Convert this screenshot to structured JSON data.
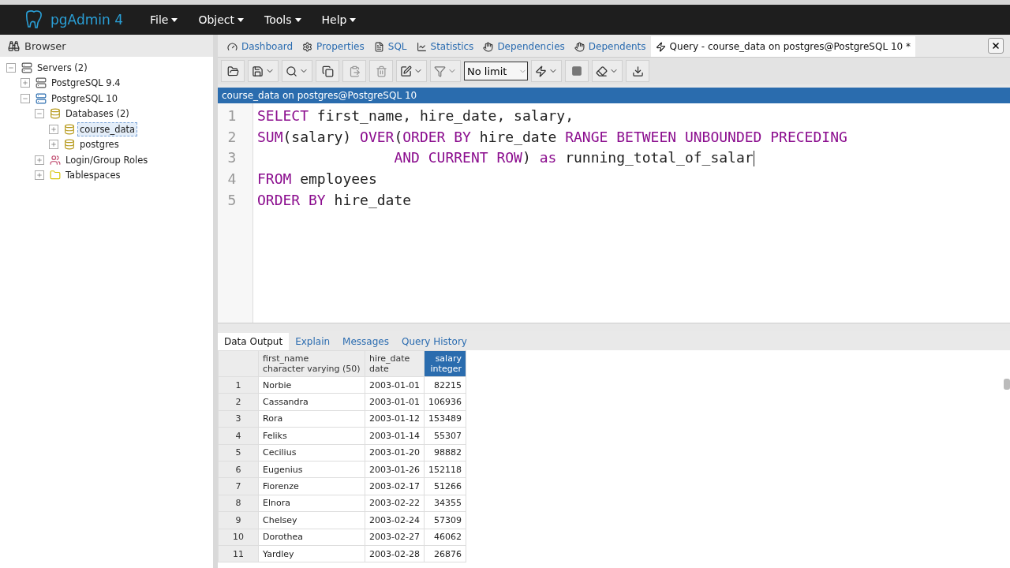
{
  "navbar": {
    "brand": "pgAdmin 4",
    "menus": [
      {
        "label": "File"
      },
      {
        "label": "Object"
      },
      {
        "label": "Tools"
      },
      {
        "label": "Help"
      }
    ]
  },
  "browser": {
    "title": "Browser",
    "tree": [
      {
        "label": "Servers (2)",
        "kind": "servers",
        "expanded": true,
        "selected": false,
        "children": [
          {
            "label": "PostgreSQL 9.4",
            "kind": "server-off",
            "expanded": false,
            "selected": false
          },
          {
            "label": "PostgreSQL 10",
            "kind": "server",
            "expanded": true,
            "selected": false,
            "children": [
              {
                "label": "Databases (2)",
                "kind": "database",
                "expanded": true,
                "selected": false,
                "children": [
                  {
                    "label": "course_data",
                    "kind": "database",
                    "expanded": false,
                    "selected": true
                  },
                  {
                    "label": "postgres",
                    "kind": "database",
                    "expanded": false,
                    "selected": false
                  }
                ]
              },
              {
                "label": "Login/Group Roles",
                "kind": "roles",
                "expanded": false,
                "selected": false
              },
              {
                "label": "Tablespaces",
                "kind": "folder",
                "expanded": false,
                "selected": false
              }
            ]
          }
        ]
      }
    ]
  },
  "tabs": [
    {
      "label": "Dashboard",
      "kind": "dashboard",
      "selected": false
    },
    {
      "label": "Properties",
      "kind": "properties",
      "selected": false
    },
    {
      "label": "SQL",
      "kind": "sql",
      "selected": false
    },
    {
      "label": "Statistics",
      "kind": "statistics",
      "selected": false
    },
    {
      "label": "Dependencies",
      "kind": "dependencies",
      "selected": false
    },
    {
      "label": "Dependents",
      "kind": "dependents",
      "selected": false
    },
    {
      "label": "Query - course_data on postgres@PostgreSQL 10 *",
      "kind": "query",
      "selected": true
    }
  ],
  "toolbar": {
    "row_limit": "No limit"
  },
  "editor": {
    "connection": "course_data on postgres@PostgreSQL 10",
    "lines": [
      {
        "number": "1",
        "tokens": [
          {
            "text": "SELECT",
            "kind": "keyword"
          },
          {
            "text": " first_name, hire_date, salary,",
            "kind": "plain"
          }
        ]
      },
      {
        "number": "2",
        "tokens": [
          {
            "text": "SUM",
            "kind": "keyword"
          },
          {
            "text": "(salary) ",
            "kind": "plain"
          },
          {
            "text": "OVER",
            "kind": "keyword"
          },
          {
            "text": "(",
            "kind": "plain"
          },
          {
            "text": "ORDER BY",
            "kind": "keyword"
          },
          {
            "text": " hire_date ",
            "kind": "plain"
          },
          {
            "text": "RANGE BETWEEN UNBOUNDED PRECEDING",
            "kind": "keyword"
          }
        ]
      },
      {
        "number": "3",
        "tokens": [
          {
            "text": "                AND CURRENT ROW",
            "kind": "keyword"
          },
          {
            "text": ") ",
            "kind": "plain"
          },
          {
            "text": "as",
            "kind": "keyword"
          },
          {
            "text": " running_total_of_salar",
            "kind": "plain"
          }
        ]
      },
      {
        "number": "4",
        "tokens": [
          {
            "text": "FROM",
            "kind": "keyword"
          },
          {
            "text": " employees",
            "kind": "plain"
          }
        ]
      },
      {
        "number": "5",
        "tokens": [
          {
            "text": "ORDER BY",
            "kind": "keyword"
          },
          {
            "text": " hire_date",
            "kind": "plain"
          }
        ]
      }
    ]
  },
  "results": {
    "tabs": [
      {
        "label": "Data Output",
        "selected": true
      },
      {
        "label": "Explain",
        "selected": false
      },
      {
        "label": "Messages",
        "selected": false
      },
      {
        "label": "Query History",
        "selected": false
      }
    ],
    "columns": [
      {
        "name": "first_name",
        "type": "character varying (50)",
        "numeric": false,
        "selected": false
      },
      {
        "name": "hire_date",
        "type": "date",
        "numeric": false,
        "selected": false
      },
      {
        "name": "salary",
        "type": "integer",
        "numeric": true,
        "selected": true
      }
    ],
    "rows": [
      {
        "number": "1",
        "cells": [
          "Norbie",
          "2003-01-01",
          "82215"
        ]
      },
      {
        "number": "2",
        "cells": [
          "Cassandra",
          "2003-01-01",
          "106936"
        ]
      },
      {
        "number": "3",
        "cells": [
          "Rora",
          "2003-01-12",
          "153489"
        ]
      },
      {
        "number": "4",
        "cells": [
          "Feliks",
          "2003-01-14",
          "55307"
        ]
      },
      {
        "number": "5",
        "cells": [
          "Cecilius",
          "2003-01-20",
          "98882"
        ]
      },
      {
        "number": "6",
        "cells": [
          "Eugenius",
          "2003-01-26",
          "152118"
        ]
      },
      {
        "number": "7",
        "cells": [
          "Fiorenze",
          "2003-02-17",
          "51266"
        ]
      },
      {
        "number": "8",
        "cells": [
          "Elnora",
          "2003-02-22",
          "34355"
        ]
      },
      {
        "number": "9",
        "cells": [
          "Chelsey",
          "2003-02-24",
          "57309"
        ]
      },
      {
        "number": "10",
        "cells": [
          "Dorothea",
          "2003-02-27",
          "46062"
        ]
      },
      {
        "number": "11",
        "cells": [
          "Yardley",
          "2003-02-28",
          "26876"
        ]
      }
    ]
  }
}
